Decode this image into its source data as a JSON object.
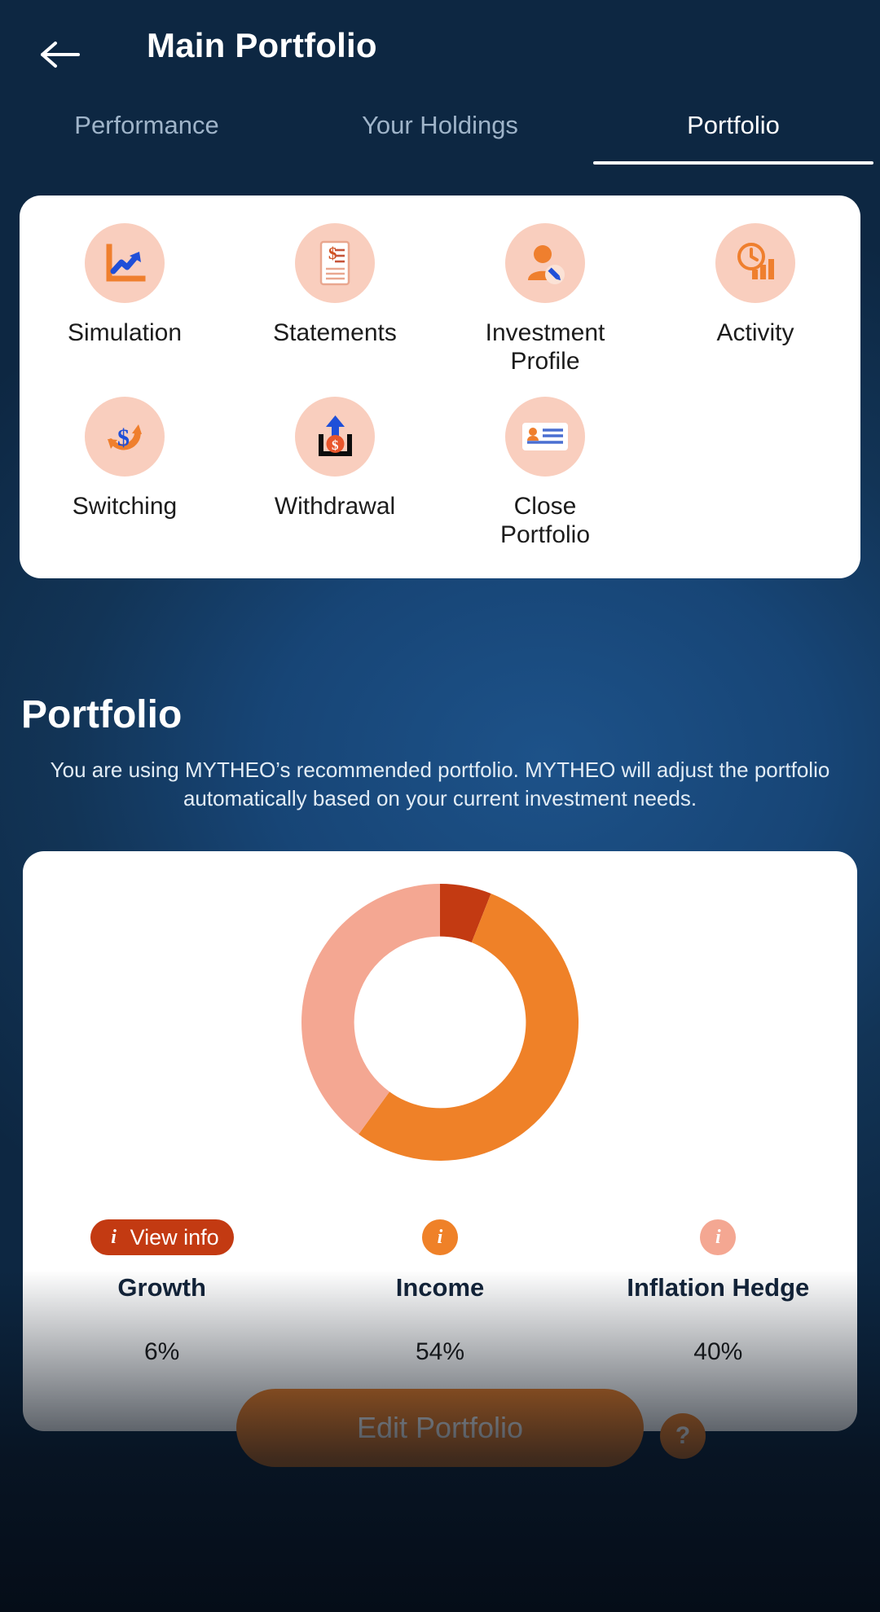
{
  "header": {
    "title": "Main Portfolio",
    "back_icon": "arrow-left-icon"
  },
  "tabs": [
    {
      "label": "Performance",
      "active": false
    },
    {
      "label": "Your Holdings",
      "active": false
    },
    {
      "label": "Portfolio",
      "active": true
    }
  ],
  "actions": [
    {
      "label": "Simulation",
      "icon": "chart-growth-icon"
    },
    {
      "label": "Statements",
      "icon": "document-dollar-icon"
    },
    {
      "label": "Investment Profile",
      "icon": "user-edit-icon"
    },
    {
      "label": "Activity",
      "icon": "clock-bars-icon"
    },
    {
      "label": "Switching",
      "icon": "refresh-dollar-icon"
    },
    {
      "label": "Withdrawal",
      "icon": "withdraw-tray-icon"
    },
    {
      "label": "Close Portfolio",
      "icon": "id-card-icon"
    }
  ],
  "portfolio": {
    "heading": "Portfolio",
    "description": "You are using MYTHEO’s recommended portfolio. MYTHEO will adjust the portfolio automatically based on your current investment needs."
  },
  "legend": [
    {
      "name": "Growth",
      "percent": "6%",
      "badge_label": "View info",
      "badge_style": "pill",
      "color": "#c33a12"
    },
    {
      "name": "Income",
      "percent": "54%",
      "badge_label": "",
      "badge_style": "dot",
      "color": "#ef8128"
    },
    {
      "name": "Inflation Hedge",
      "percent": "40%",
      "badge_label": "",
      "badge_style": "dot",
      "color": "#f4a792"
    }
  ],
  "footer": {
    "edit_label": "Edit Portfolio",
    "help_label": "?"
  },
  "chart_data": {
    "type": "pie",
    "title": "Portfolio allocation",
    "categories": [
      "Growth",
      "Income",
      "Inflation Hedge"
    ],
    "values": [
      6,
      54,
      40
    ],
    "colors": [
      "#c33a12",
      "#ef8128",
      "#f4a792"
    ],
    "unit": "%",
    "donut": true,
    "inner_radius_ratio": 0.62,
    "start_angle_deg": 0,
    "legend_position": "bottom",
    "grid": false
  }
}
